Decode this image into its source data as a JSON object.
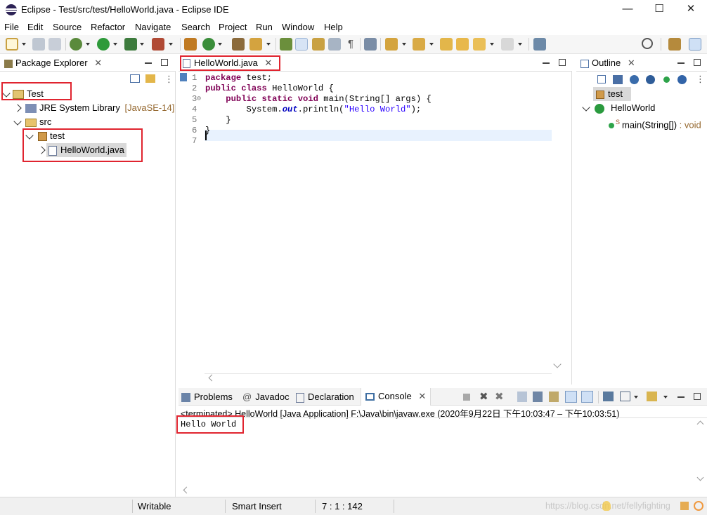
{
  "window": {
    "title": "Eclipse - Test/src/test/HelloWorld.java - Eclipse IDE",
    "min": "—",
    "max": "☐",
    "close": "✕"
  },
  "menu": [
    "File",
    "Edit",
    "Source",
    "Refactor",
    "Navigate",
    "Search",
    "Project",
    "Run",
    "Window",
    "Help"
  ],
  "package_explorer": {
    "tab": "Package Explorer",
    "tree": {
      "project": "Test",
      "jre": "JRE System Library",
      "jre_version": "[JavaSE-14]",
      "src": "src",
      "package": "test",
      "file": "HelloWorld.java"
    }
  },
  "editor": {
    "tab": "HelloWorld.java",
    "lines": [
      "1",
      "2",
      "3",
      "4",
      "5",
      "6",
      "7"
    ],
    "fold_marker": "⊖",
    "code": {
      "l1_kw": "package",
      "l1_rest": " test;",
      "l2_kw1": "public",
      "l2_kw2": "class",
      "l2_rest": " HelloWorld {",
      "l3_kw1": "public",
      "l3_kw2": "static",
      "l3_kw3": "void",
      "l3_rest": " main(String[] args) {",
      "l4_a": "System.",
      "l4_b": "out",
      "l4_c": ".println(",
      "l4_str": "\"Hello World\"",
      "l4_d": ");",
      "l5": "}",
      "l6": "}"
    }
  },
  "outline": {
    "tab": "Outline",
    "package": "test",
    "class": "HelloWorld",
    "method": "main(String[])",
    "method_type": " : void",
    "static_mark": "S"
  },
  "bottom": {
    "tabs": [
      "Problems",
      "Javadoc",
      "Declaration",
      "Console"
    ],
    "tab_icons": [
      "problems-icon",
      "javadoc-icon",
      "declaration-icon",
      "console-icon"
    ],
    "console_header": "<terminated> HelloWorld [Java Application] F:\\Java\\bin\\javaw.exe  (2020年9月22日 下午10:03:47 – 下午10:03:51)",
    "console_output": "Hello World"
  },
  "status": {
    "writable": "Writable",
    "insert_mode": "Smart Insert",
    "position": "7 : 1 : 142",
    "watermark": "https://blog.csdn.net/fellyfighting"
  },
  "colors": {
    "keyword": "#7f0055",
    "string": "#2a00ff",
    "highlight": "#e0242f",
    "current_line": "#e8f2fe",
    "selection": "#d9d9d9"
  }
}
